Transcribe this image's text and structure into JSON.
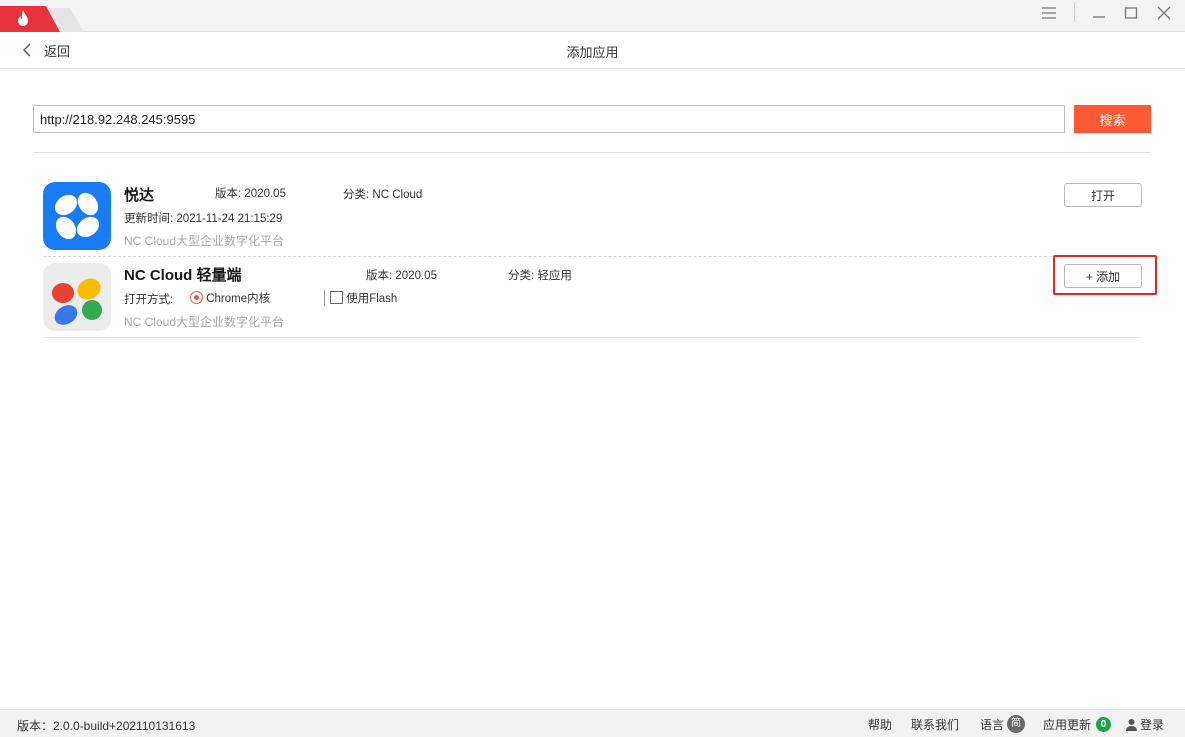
{
  "titlebar": {
    "tab_icon": "flame-icon",
    "window_controls": [
      "menu-icon",
      "minimize-icon",
      "maximize-icon",
      "close-icon"
    ]
  },
  "header": {
    "back_label": "返回",
    "title": "添加应用"
  },
  "search": {
    "value": "http://218.92.248.245:9595",
    "button_label": "搜索",
    "accent_color": "#fc5a35"
  },
  "apps": [
    {
      "name": "悦达",
      "version_label": "版本:",
      "version": "2020.05",
      "category_label": "分类:",
      "category": "NC Cloud",
      "update_label": "更新时间:",
      "update_time": "2021-11-24 21:15:29",
      "description": "NC  Cloud大型企业数字化平台",
      "action_label": "打开",
      "icon_color": "#1a7cf5"
    },
    {
      "name": "NC Cloud 轻量端",
      "version_label": "版本:",
      "version": "2020.05",
      "category_label": "分类:",
      "category": "轻应用",
      "open_mode_label": "打开方式:",
      "option_chrome": "Chrome内核",
      "option_flash": "使用Flash",
      "description": "NC  Cloud大型企业数字化平台",
      "action_label": "+ 添加"
    }
  ],
  "statusbar": {
    "version": "版本：2.0.0-build+202110131613",
    "help": "帮助",
    "contact": "联系我们",
    "language": "语言",
    "language_badge": "简",
    "update": "应用更新",
    "update_count": "0",
    "login": "登录"
  }
}
